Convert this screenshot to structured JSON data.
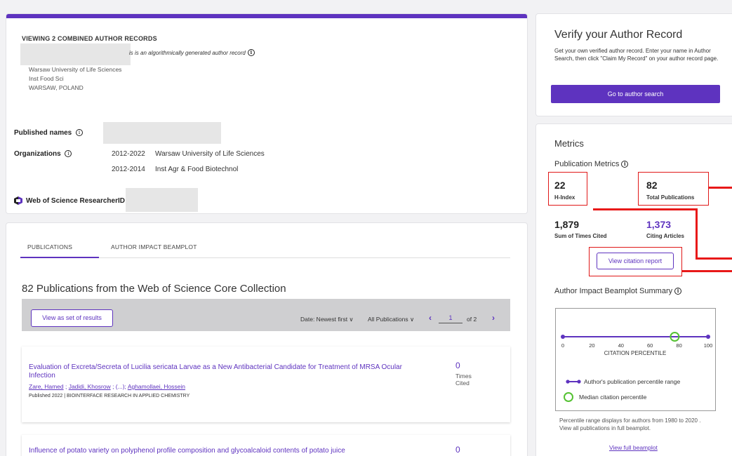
{
  "author": {
    "viewing_label": "VIEWING 2 COMBINED AUTHOR RECORDS",
    "algo_note": "is is an algorithmically generated author record",
    "info_glyph": "i",
    "affiliations": [
      "Warsaw University of Life Sciences",
      "Inst Food Sci",
      "WARSAW, POLAND"
    ],
    "published_names_label": "Published names",
    "organizations_label": "Organizations",
    "organizations": [
      {
        "years": "2012-2022",
        "name": "Warsaw University of Life Sciences"
      },
      {
        "years": "2012-2014",
        "name": "Inst Agr & Food Biotechnol"
      }
    ],
    "researcher_id_label": "Web of Science ResearcherID:"
  },
  "tabs": [
    {
      "label": "PUBLICATIONS"
    },
    {
      "label": "AUTHOR IMPACT BEAMPLOT"
    }
  ],
  "publications": {
    "title": "82 Publications from the Web of Science Core Collection",
    "view_set_label": "View as set of results",
    "sort_label": "Date: Newest first ∨",
    "filter_label": "All Publications ∨",
    "prev_glyph": "‹",
    "next_glyph": "›",
    "page": "1",
    "page_total": "of 2",
    "records": [
      {
        "title": "Evaluation of Excreta/Secreta of Lucilia sericata Larvae as a New Antibacterial Candidate for Treatment of MRSA Ocular Infection",
        "author1": "Zare, Hamed",
        "sep1": " ; ",
        "author2": "Jadidi, Khosrow",
        "sep2": " ; (...); ",
        "author3": "Aghamollaei, Hossein",
        "meta": "Published 2022 | BIOINTERFACE RESEARCH IN APPLIED CHEMISTRY",
        "times_cited": "0",
        "times_cited_label": "Times Cited"
      },
      {
        "title": "Influence of potato variety on polyphenol profile composition and glycoalcaloid contents of potato juice",
        "times_cited": "0"
      }
    ]
  },
  "verify": {
    "title": "Verify your Author Record",
    "text": "Get your own verified author record. Enter your name in Author Search, then click \"Claim My Record\" on your author record page.",
    "button": "Go to author search"
  },
  "metrics": {
    "title": "Metrics",
    "publication_metrics_label": "Publication Metrics",
    "h_index": "22",
    "h_index_label": "H-Index",
    "total_publications": "82",
    "total_publications_label": "Total Publications",
    "times_cited": "1,879",
    "times_cited_label": "Sum of Times Cited",
    "citing_articles": "1,373",
    "citing_articles_label": "Citing Articles",
    "citation_report_button": "View citation report",
    "beamplot_title": "Author Impact Beamplot Summary",
    "beamplot": {
      "ticks": [
        "0",
        "20",
        "40",
        "60",
        "80",
        "100"
      ],
      "axis_label": "CITATION PERCENTILE",
      "range": [
        0,
        100
      ],
      "median": 77,
      "legend_range": "Author's publication percentile range",
      "legend_median": "Median citation percentile"
    },
    "beamplot_note": "Percentile range displays for authors from 1980 to 2020 . View all publications in full beamplot.",
    "beamplot_link": "View full beamplot"
  },
  "colors": {
    "accent": "#5e33bf",
    "median": "#55c233",
    "highlight": "#e01818"
  }
}
